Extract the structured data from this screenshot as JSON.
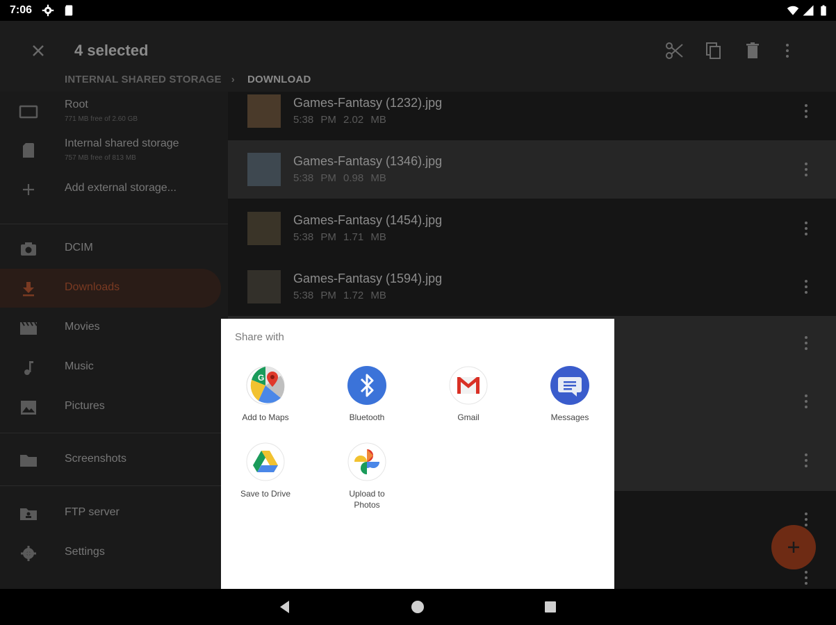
{
  "status": {
    "time": "7:06"
  },
  "appbar": {
    "title": "4 selected"
  },
  "breadcrumb": {
    "root": "INTERNAL SHARED STORAGE",
    "current": "DOWNLOAD"
  },
  "drawer": {
    "root": {
      "label": "Root",
      "sub": "771 MB free of 2.60 GB"
    },
    "internal": {
      "label": "Internal shared storage",
      "sub": "757 MB free of 813 MB"
    },
    "add_external": "Add external storage...",
    "dcim": "DCIM",
    "downloads": "Downloads",
    "movies": "Movies",
    "music": "Music",
    "pictures": "Pictures",
    "screenshots": "Screenshots",
    "ftp": "FTP server",
    "settings": "Settings"
  },
  "files": [
    {
      "name": "Games-Fantasy (1232).jpg",
      "meta": "5:38 PM 2.02 MB"
    },
    {
      "name": "Games-Fantasy (1346).jpg",
      "meta": "5:38 PM 0.98 MB"
    },
    {
      "name": "Games-Fantasy (1454).jpg",
      "meta": "5:38 PM 1.71 MB"
    },
    {
      "name": "Games-Fantasy (1594).jpg",
      "meta": "5:38 PM 1.72 MB"
    }
  ],
  "share": {
    "title": "Share with",
    "targets": {
      "maps": "Add to Maps",
      "bluetooth": "Bluetooth",
      "gmail": "Gmail",
      "messages": "Messages",
      "drive": "Save to Drive",
      "photos_line1": "Upload to",
      "photos_line2": "Photos"
    }
  },
  "colors": {
    "accent": "#e0542b",
    "bluetooth": "#3b73d9",
    "messages": "#3a5ccc"
  }
}
